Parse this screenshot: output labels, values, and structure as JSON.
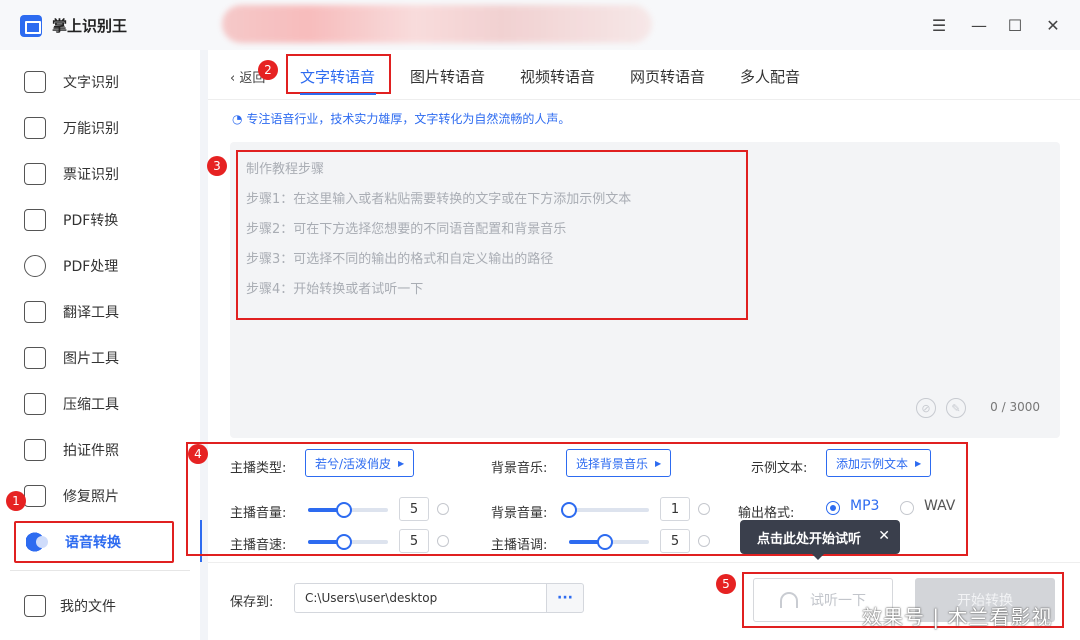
{
  "app": {
    "title": "掌上识别王"
  },
  "sidebar": {
    "items": [
      {
        "label": "文字识别",
        "icon": "text-recognition-icon"
      },
      {
        "label": "万能识别",
        "icon": "universal-recognition-icon"
      },
      {
        "label": "票证识别",
        "icon": "ticket-recognition-icon"
      },
      {
        "label": "PDF转换",
        "icon": "pdf-convert-icon"
      },
      {
        "label": "PDF处理",
        "icon": "pdf-process-icon"
      },
      {
        "label": "翻译工具",
        "icon": "translate-icon"
      },
      {
        "label": "图片工具",
        "icon": "image-tools-icon"
      },
      {
        "label": "压缩工具",
        "icon": "compress-icon"
      },
      {
        "label": "拍证件照",
        "icon": "id-photo-icon"
      },
      {
        "label": "修复照片",
        "icon": "repair-photo-icon"
      },
      {
        "label": "语音转换",
        "icon": "voice-convert-icon",
        "active": true
      }
    ],
    "my_files": "我的文件"
  },
  "nav": {
    "back": "返回"
  },
  "tabs": [
    "文字转语音",
    "图片转语音",
    "视频转语音",
    "网页转语音",
    "多人配音"
  ],
  "tip": "专注语音行业，技术实力雄厚，文字转化为自然流畅的人声。",
  "editor": {
    "steps": [
      "制作教程步骤",
      "步骤1：在这里输入或者粘贴需要转换的文字或在下方添加示例文本",
      "步骤2：可在下方选择您想要的不同语音配置和背景音乐",
      "步骤3：可选择不同的输出的格式和自定义输出的路径",
      "步骤4：开始转换或者试听一下"
    ],
    "counter": "0 / 3000"
  },
  "settings": {
    "anchor_type_label": "主播类型:",
    "anchor_type_value": "若兮/活泼俏皮",
    "bgm_label": "背景音乐:",
    "bgm_value": "选择背景音乐",
    "sample_label": "示例文本:",
    "sample_value": "添加示例文本",
    "anchor_volume_label": "主播音量:",
    "anchor_volume": "5",
    "bgm_volume_label": "背景音量:",
    "bgm_volume": "1",
    "output_format_label": "输出格式:",
    "formats": [
      "MP3",
      "WAV"
    ],
    "selected_format": "MP3",
    "anchor_speed_label": "主播音速:",
    "anchor_speed": "5",
    "anchor_pitch_label": "主播语调:",
    "anchor_pitch": "5",
    "slider_fraction": {
      "anchor_volume": 0.45,
      "bgm_volume": 0.0,
      "anchor_speed": 0.45,
      "anchor_pitch": 0.45
    }
  },
  "tooltip": {
    "text": "点击此处开始试听"
  },
  "footer": {
    "save_label": "保存到:",
    "save_path": "C:\\Users\\user\\desktop",
    "more": "···",
    "listen_button": "试听一下",
    "convert_button": "开始转换"
  },
  "badges": [
    "1",
    "2",
    "3",
    "4",
    "5"
  ],
  "watermark": "效果号 | 木兰看影视",
  "colors": {
    "accent": "#2d6bf0",
    "annotation": "#e02020"
  }
}
